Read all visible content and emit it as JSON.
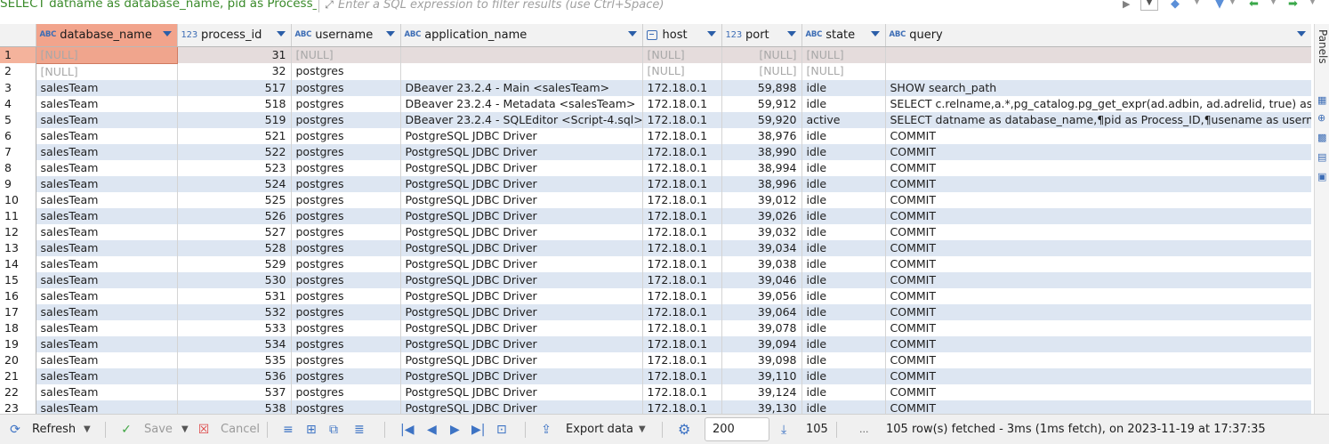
{
  "filter": {
    "sql_text": "SELECT datname as database_name, pid as Process_I",
    "placeholder": "Enter a SQL expression to filter results (use Ctrl+Space)"
  },
  "columns": [
    {
      "name": "database_name",
      "type": "ABC",
      "sorted": true
    },
    {
      "name": "process_id",
      "type": "123"
    },
    {
      "name": "username",
      "type": "ABC"
    },
    {
      "name": "application_name",
      "type": "ABC"
    },
    {
      "name": "host",
      "type": "inet"
    },
    {
      "name": "port",
      "type": "123"
    },
    {
      "name": "state",
      "type": "ABC"
    },
    {
      "name": "query",
      "type": "ABC"
    }
  ],
  "rows": [
    {
      "n": "1",
      "db": "[NULL]",
      "pid": "31",
      "user": "[NULL]",
      "app": "",
      "host": "[NULL]",
      "port": "[NULL]",
      "state": "[NULL]",
      "query": ""
    },
    {
      "n": "2",
      "db": "[NULL]",
      "pid": "32",
      "user": "postgres",
      "app": "",
      "host": "[NULL]",
      "port": "[NULL]",
      "state": "[NULL]",
      "query": ""
    },
    {
      "n": "3",
      "db": "salesTeam",
      "pid": "517",
      "user": "postgres",
      "app": "DBeaver 23.2.4 - Main <salesTeam>",
      "host": "172.18.0.1",
      "port": "59,898",
      "state": "idle",
      "query": "SHOW search_path"
    },
    {
      "n": "4",
      "db": "salesTeam",
      "pid": "518",
      "user": "postgres",
      "app": "DBeaver 23.2.4 - Metadata <salesTeam>",
      "host": "172.18.0.1",
      "port": "59,912",
      "state": "idle",
      "query": "SELECT c.relname,a.*,pg_catalog.pg_get_expr(ad.adbin, ad.adrelid, true) as d"
    },
    {
      "n": "5",
      "db": "salesTeam",
      "pid": "519",
      "user": "postgres",
      "app": "DBeaver 23.2.4 - SQLEditor <Script-4.sql>",
      "host": "172.18.0.1",
      "port": "59,920",
      "state": "active",
      "query": "SELECT datname as database_name,¶pid as Process_ID,¶usename as usernam"
    },
    {
      "n": "6",
      "db": "salesTeam",
      "pid": "521",
      "user": "postgres",
      "app": "PostgreSQL JDBC Driver",
      "host": "172.18.0.1",
      "port": "38,976",
      "state": "idle",
      "query": "COMMIT"
    },
    {
      "n": "7",
      "db": "salesTeam",
      "pid": "522",
      "user": "postgres",
      "app": "PostgreSQL JDBC Driver",
      "host": "172.18.0.1",
      "port": "38,990",
      "state": "idle",
      "query": "COMMIT"
    },
    {
      "n": "8",
      "db": "salesTeam",
      "pid": "523",
      "user": "postgres",
      "app": "PostgreSQL JDBC Driver",
      "host": "172.18.0.1",
      "port": "38,994",
      "state": "idle",
      "query": "COMMIT"
    },
    {
      "n": "9",
      "db": "salesTeam",
      "pid": "524",
      "user": "postgres",
      "app": "PostgreSQL JDBC Driver",
      "host": "172.18.0.1",
      "port": "38,996",
      "state": "idle",
      "query": "COMMIT"
    },
    {
      "n": "10",
      "db": "salesTeam",
      "pid": "525",
      "user": "postgres",
      "app": "PostgreSQL JDBC Driver",
      "host": "172.18.0.1",
      "port": "39,012",
      "state": "idle",
      "query": "COMMIT"
    },
    {
      "n": "11",
      "db": "salesTeam",
      "pid": "526",
      "user": "postgres",
      "app": "PostgreSQL JDBC Driver",
      "host": "172.18.0.1",
      "port": "39,026",
      "state": "idle",
      "query": "COMMIT"
    },
    {
      "n": "12",
      "db": "salesTeam",
      "pid": "527",
      "user": "postgres",
      "app": "PostgreSQL JDBC Driver",
      "host": "172.18.0.1",
      "port": "39,032",
      "state": "idle",
      "query": "COMMIT"
    },
    {
      "n": "13",
      "db": "salesTeam",
      "pid": "528",
      "user": "postgres",
      "app": "PostgreSQL JDBC Driver",
      "host": "172.18.0.1",
      "port": "39,034",
      "state": "idle",
      "query": "COMMIT"
    },
    {
      "n": "14",
      "db": "salesTeam",
      "pid": "529",
      "user": "postgres",
      "app": "PostgreSQL JDBC Driver",
      "host": "172.18.0.1",
      "port": "39,038",
      "state": "idle",
      "query": "COMMIT"
    },
    {
      "n": "15",
      "db": "salesTeam",
      "pid": "530",
      "user": "postgres",
      "app": "PostgreSQL JDBC Driver",
      "host": "172.18.0.1",
      "port": "39,046",
      "state": "idle",
      "query": "COMMIT"
    },
    {
      "n": "16",
      "db": "salesTeam",
      "pid": "531",
      "user": "postgres",
      "app": "PostgreSQL JDBC Driver",
      "host": "172.18.0.1",
      "port": "39,056",
      "state": "idle",
      "query": "COMMIT"
    },
    {
      "n": "17",
      "db": "salesTeam",
      "pid": "532",
      "user": "postgres",
      "app": "PostgreSQL JDBC Driver",
      "host": "172.18.0.1",
      "port": "39,064",
      "state": "idle",
      "query": "COMMIT"
    },
    {
      "n": "18",
      "db": "salesTeam",
      "pid": "533",
      "user": "postgres",
      "app": "PostgreSQL JDBC Driver",
      "host": "172.18.0.1",
      "port": "39,078",
      "state": "idle",
      "query": "COMMIT"
    },
    {
      "n": "19",
      "db": "salesTeam",
      "pid": "534",
      "user": "postgres",
      "app": "PostgreSQL JDBC Driver",
      "host": "172.18.0.1",
      "port": "39,094",
      "state": "idle",
      "query": "COMMIT"
    },
    {
      "n": "20",
      "db": "salesTeam",
      "pid": "535",
      "user": "postgres",
      "app": "PostgreSQL JDBC Driver",
      "host": "172.18.0.1",
      "port": "39,098",
      "state": "idle",
      "query": "COMMIT"
    },
    {
      "n": "21",
      "db": "salesTeam",
      "pid": "536",
      "user": "postgres",
      "app": "PostgreSQL JDBC Driver",
      "host": "172.18.0.1",
      "port": "39,110",
      "state": "idle",
      "query": "COMMIT"
    },
    {
      "n": "22",
      "db": "salesTeam",
      "pid": "537",
      "user": "postgres",
      "app": "PostgreSQL JDBC Driver",
      "host": "172.18.0.1",
      "port": "39,124",
      "state": "idle",
      "query": "COMMIT"
    },
    {
      "n": "23",
      "db": "salesTeam",
      "pid": "538",
      "user": "postgres",
      "app": "PostgreSQL JDBC Driver",
      "host": "172.18.0.1",
      "port": "39,130",
      "state": "idle",
      "query": "COMMIT"
    }
  ],
  "panels": {
    "label": "Panels"
  },
  "bottom": {
    "refresh": "Refresh",
    "save": "Save",
    "cancel": "Cancel",
    "export": "Export data",
    "fetch_size": "200",
    "row_count": "105",
    "more": "...",
    "status": "105 row(s) fetched - 3ms (1ms fetch), on 2023-11-19 at 17:37:35"
  },
  "colors": {
    "sorted_header": "#f2a48c",
    "alt_row": "#dde6f2",
    "sql_green": "#3a8a2a",
    "icon_blue": "#3d73c4"
  }
}
